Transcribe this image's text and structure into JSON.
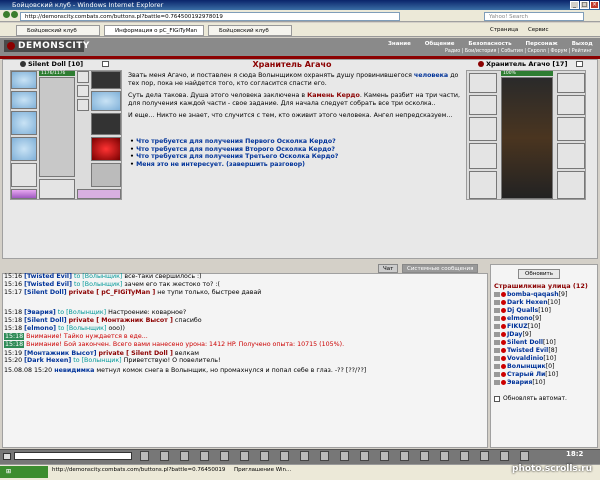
{
  "window": {
    "title": "Бойцовский клуб - Windows Internet Explorer",
    "address": "http://demonscity.combats.com/buttons.pl?battle=0.764500192978019",
    "search_placeholder": "Yahoo! Search"
  },
  "browser_tabs": [
    {
      "label": "Бойцовский клуб"
    },
    {
      "label": "Информация о pC_FIGiTyMan"
    },
    {
      "label": "Бойцовский клуб"
    }
  ],
  "browser_toolbar": {
    "page_label": "Страница",
    "service_label": "Сервис"
  },
  "game_header": {
    "logo": "DEMONSCITY",
    "nav": [
      "Знание",
      "Общение",
      "Безопасность",
      "Персонаж",
      "Выход"
    ],
    "subnav": "Радио | Бои/история | События | Скролл | Форум | Рейтинг"
  },
  "left_doll": {
    "name": "Silent Doll",
    "level": "[10]",
    "hp": "1176/1176"
  },
  "npc": {
    "title": "Хранитель Агачо",
    "paragraphs": [
      {
        "pre": "Звать меня Агачо, и поставлен я сюда Волынщиком охранять душу провинившегося ",
        "em": "человека",
        "post": " до тех пор, пока не найдется того, кто согласится спасти его."
      },
      {
        "pre": "Суть дела такова. Душа этого человека заключена в ",
        "em": "Камень Кердо",
        "post": ". Камень разбит на три части, для получения каждой части - свое задание. Для начала следует собрать все три осколка.."
      },
      {
        "pre": "И еще... Никто не знает, что случится с тем, кто оживит этого человека. Ангел непредсказуем...",
        "em": "",
        "post": ""
      }
    ],
    "options": [
      "Что требуется для получения Первого Осколка Кердо?",
      "Что требуется для получения Второго Осколка Кердо?",
      "Что требуется для получения Третьего Осколка Кердо?",
      "Меня это не интересует. (завершить разговор)"
    ]
  },
  "right_doll": {
    "name": "Хранитель Агачо",
    "level": "[17]",
    "hp": "100%"
  },
  "chat_tabs": [
    "Чат",
    "Системные сообщения"
  ],
  "chat": [
    {
      "time": "15:16",
      "hl": false,
      "nick": "[Twisted Evil]",
      "to": "to [Волынщик]",
      "priv": "",
      "text": "все-таки свершилось :)"
    },
    {
      "time": "15:16",
      "hl": false,
      "nick": "[Twisted Evil]",
      "to": "to [Волынщик]",
      "priv": "",
      "text": "зачем его так жестоко то? :("
    },
    {
      "time": "15:17",
      "hl": false,
      "nick": "[Silent Doll]",
      "to": "",
      "priv": "private [ pC_FIGiTyMan ]",
      "text": "не тупи только, быстрее давай"
    },
    {
      "time": "15:18",
      "hl": false,
      "nick": "[Эвария]",
      "to": "to [Волынщик]",
      "priv": "",
      "text": "Настроение: коварное?"
    },
    {
      "time": "15:18",
      "hl": false,
      "nick": "[Silent Doll]",
      "to": "",
      "priv": "private [ Монтажник Высот ]",
      "text": "спасибо"
    },
    {
      "time": "15:18",
      "hl": false,
      "nick": "[elmono]",
      "to": "to [Волынщик]",
      "priv": "",
      "text": "ооо))"
    },
    {
      "time": "15:18",
      "hl": true,
      "nick": "",
      "to": "",
      "priv": "",
      "text": "Внимание! Тайко нуждается в еде..."
    },
    {
      "time": "15:18",
      "hl": true,
      "nick": "",
      "to": "",
      "priv": "",
      "text": "Внимание! Бой закончен. Всего вами нанесено урона: 1412 HP. Получено опыта: 10715 (105%)."
    },
    {
      "time": "15:19",
      "hl": false,
      "nick": "[Монтажник Высот]",
      "to": "",
      "priv": "private [ Silent Doll ]",
      "text": "велкам"
    },
    {
      "time": "15:20",
      "hl": false,
      "nick": "[Dark Hexen]",
      "to": "to [Волынщик]",
      "priv": "",
      "text": "Приветствую! О повелитель!"
    },
    {
      "time": "15.08.08 15:20",
      "hl": false,
      "nick": "невидимка",
      "to": "",
      "priv": "",
      "text": "метнул комок снега в Волынщик, но промахнулся и попал себе в глаз. -?? [??/??]"
    }
  ],
  "online": {
    "refresh_label": "Обновить",
    "room": "Страшилкина улица (12)",
    "users": [
      {
        "name": "bomba-qaqash",
        "lvl": "[9]"
      },
      {
        "name": "Dark Hexen",
        "lvl": "[10]"
      },
      {
        "name": "Dj Qualls",
        "lvl": "[10]"
      },
      {
        "name": "elmono",
        "lvl": "[9]"
      },
      {
        "name": "FIKUZ",
        "lvl": "[10]"
      },
      {
        "name": "JDay",
        "lvl": "[9]"
      },
      {
        "name": "Silent Doll",
        "lvl": "[10]"
      },
      {
        "name": "Twisted Evil",
        "lvl": "[8]"
      },
      {
        "name": "Vovaldinio",
        "lvl": "[10]"
      },
      {
        "name": "Волынщик",
        "lvl": "[0]"
      },
      {
        "name": "Старый Ли",
        "lvl": "[10]"
      },
      {
        "name": "Эвария",
        "lvl": "[10]"
      }
    ],
    "autorefresh_label": "Обновлять автомат."
  },
  "bottom": {
    "clock": "18:2"
  },
  "status": {
    "url": "http://demonscity.combats.com/buttons.pl?battle=0.76450019",
    "tab2": "Приглашение Win..."
  },
  "watermark": "photo.scrolls.ru"
}
